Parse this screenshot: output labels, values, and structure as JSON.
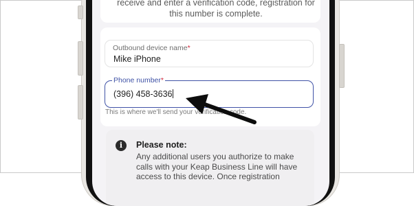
{
  "top_card": {
    "text": "receive and enter a verification code, registration for this number is complete."
  },
  "form": {
    "device_name": {
      "label": "Outbound device name",
      "required_mark": "*",
      "value": "Mike iPhone"
    },
    "phone_number": {
      "label": "Phone number",
      "required_mark": "*",
      "value": "(396) 458-3636"
    },
    "helper_text": "This is where we'll send your verification code."
  },
  "note": {
    "icon": "info-icon",
    "title": "Please note:",
    "body": "Any additional users you authorize to make calls with your Keap Business Line will have access to this device. Once registration"
  },
  "colors": {
    "accent": "#3f52a6",
    "required": "#d2263a",
    "arrow": "#0d0d0d"
  }
}
